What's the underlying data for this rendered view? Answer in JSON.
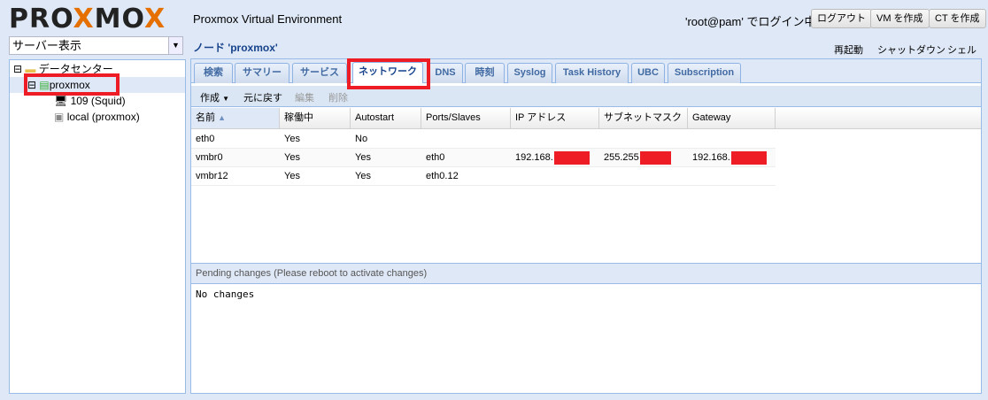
{
  "header": {
    "logo": "PROXMOX",
    "title": "Proxmox Virtual Environment",
    "login_text": "'root@pam' でログイン中",
    "logout": "ログアウト",
    "create_vm": "VM を作成",
    "create_ct": "CT を作成"
  },
  "sidebar": {
    "view_select": "サーバー表示",
    "tree": [
      {
        "label": "データセンター"
      },
      {
        "label": "proxmox"
      },
      {
        "label": "109 (Squid)"
      },
      {
        "label": "local (proxmox)"
      }
    ]
  },
  "node": {
    "title": "ノード 'proxmox'",
    "actions": [
      "再起動",
      "シャットダウン",
      "シェル"
    ]
  },
  "tabs": [
    "検索",
    "サマリー",
    "サービス",
    "ネットワーク",
    "DNS",
    "時刻",
    "Syslog",
    "Task History",
    "UBC",
    "Subscription"
  ],
  "active_tab": "ネットワーク",
  "toolbar": {
    "create": "作成",
    "revert": "元に戻す",
    "edit": "編集",
    "remove": "削除"
  },
  "grid": {
    "columns": [
      "名前",
      "稼働中",
      "Autostart",
      "Ports/Slaves",
      "IP アドレス",
      "サブネットマスク",
      "Gateway"
    ],
    "rows": [
      [
        "eth0",
        "Yes",
        "No",
        "",
        "",
        "",
        ""
      ],
      [
        "vmbr0",
        "Yes",
        "Yes",
        "eth0",
        "192.168.",
        "255.255",
        "192.168."
      ],
      [
        "vmbr12",
        "Yes",
        "Yes",
        "eth0.12",
        "",
        "",
        ""
      ]
    ]
  },
  "pending": {
    "title": "Pending changes (Please reboot to activate changes)",
    "body": "No changes"
  }
}
